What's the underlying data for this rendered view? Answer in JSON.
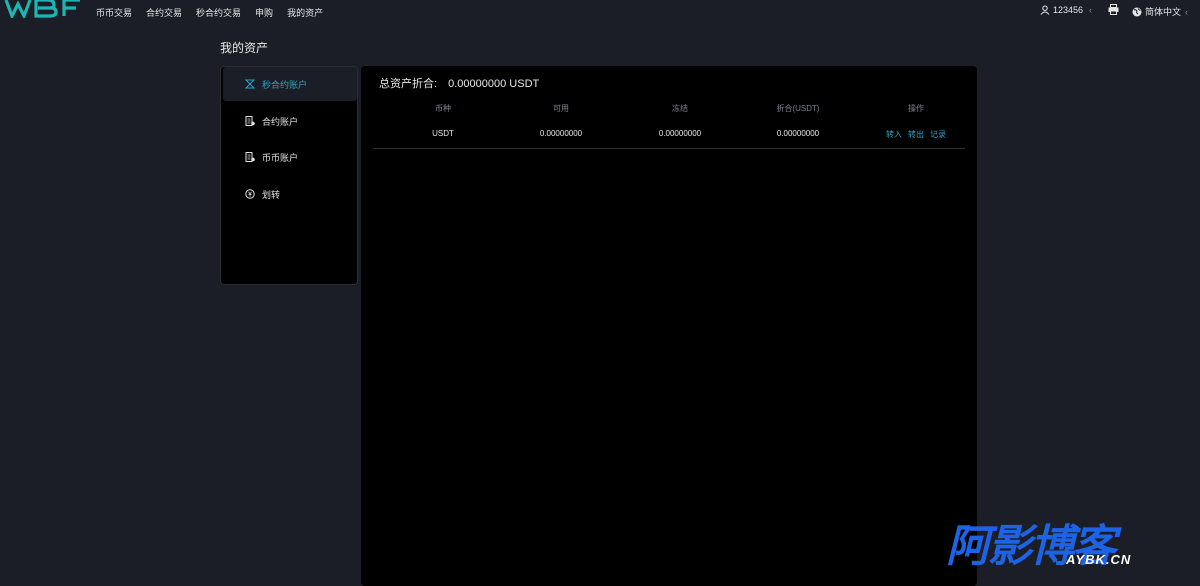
{
  "nav": {
    "items": [
      "币币交易",
      "合约交易",
      "秒合约交易",
      "申购",
      "我的资产"
    ]
  },
  "user": {
    "name": "123456"
  },
  "language": {
    "label": "简体中文"
  },
  "page": {
    "title": "我的资产"
  },
  "sidebar": {
    "items": [
      {
        "label": "秒合约账户",
        "icon": "seconds-contract-icon",
        "active": true
      },
      {
        "label": "合约账户",
        "icon": "contract-account-icon",
        "active": false
      },
      {
        "label": "币币账户",
        "icon": "coin-account-icon",
        "active": false
      },
      {
        "label": "划转",
        "icon": "transfer-icon",
        "active": false
      }
    ]
  },
  "summary": {
    "label": "总资产折合:",
    "value": "0.00000000 USDT"
  },
  "table": {
    "headers": [
      "币种",
      "可用",
      "冻结",
      "折合(USDT)",
      "操作"
    ],
    "rows": [
      {
        "coin": "USDT",
        "available": "0.00000000",
        "frozen": "0.00000000",
        "converted": "0.00000000",
        "actions": [
          "转入",
          "转出",
          "记录"
        ]
      }
    ]
  },
  "watermark": {
    "main": "阿影博客",
    "sub": "AYBK.CN"
  },
  "colors": {
    "accent": "#2fa3c7",
    "background": "#1b1e27",
    "panel": "#000000",
    "logo": "#1fb5b0",
    "watermark": "#1d63e6"
  }
}
